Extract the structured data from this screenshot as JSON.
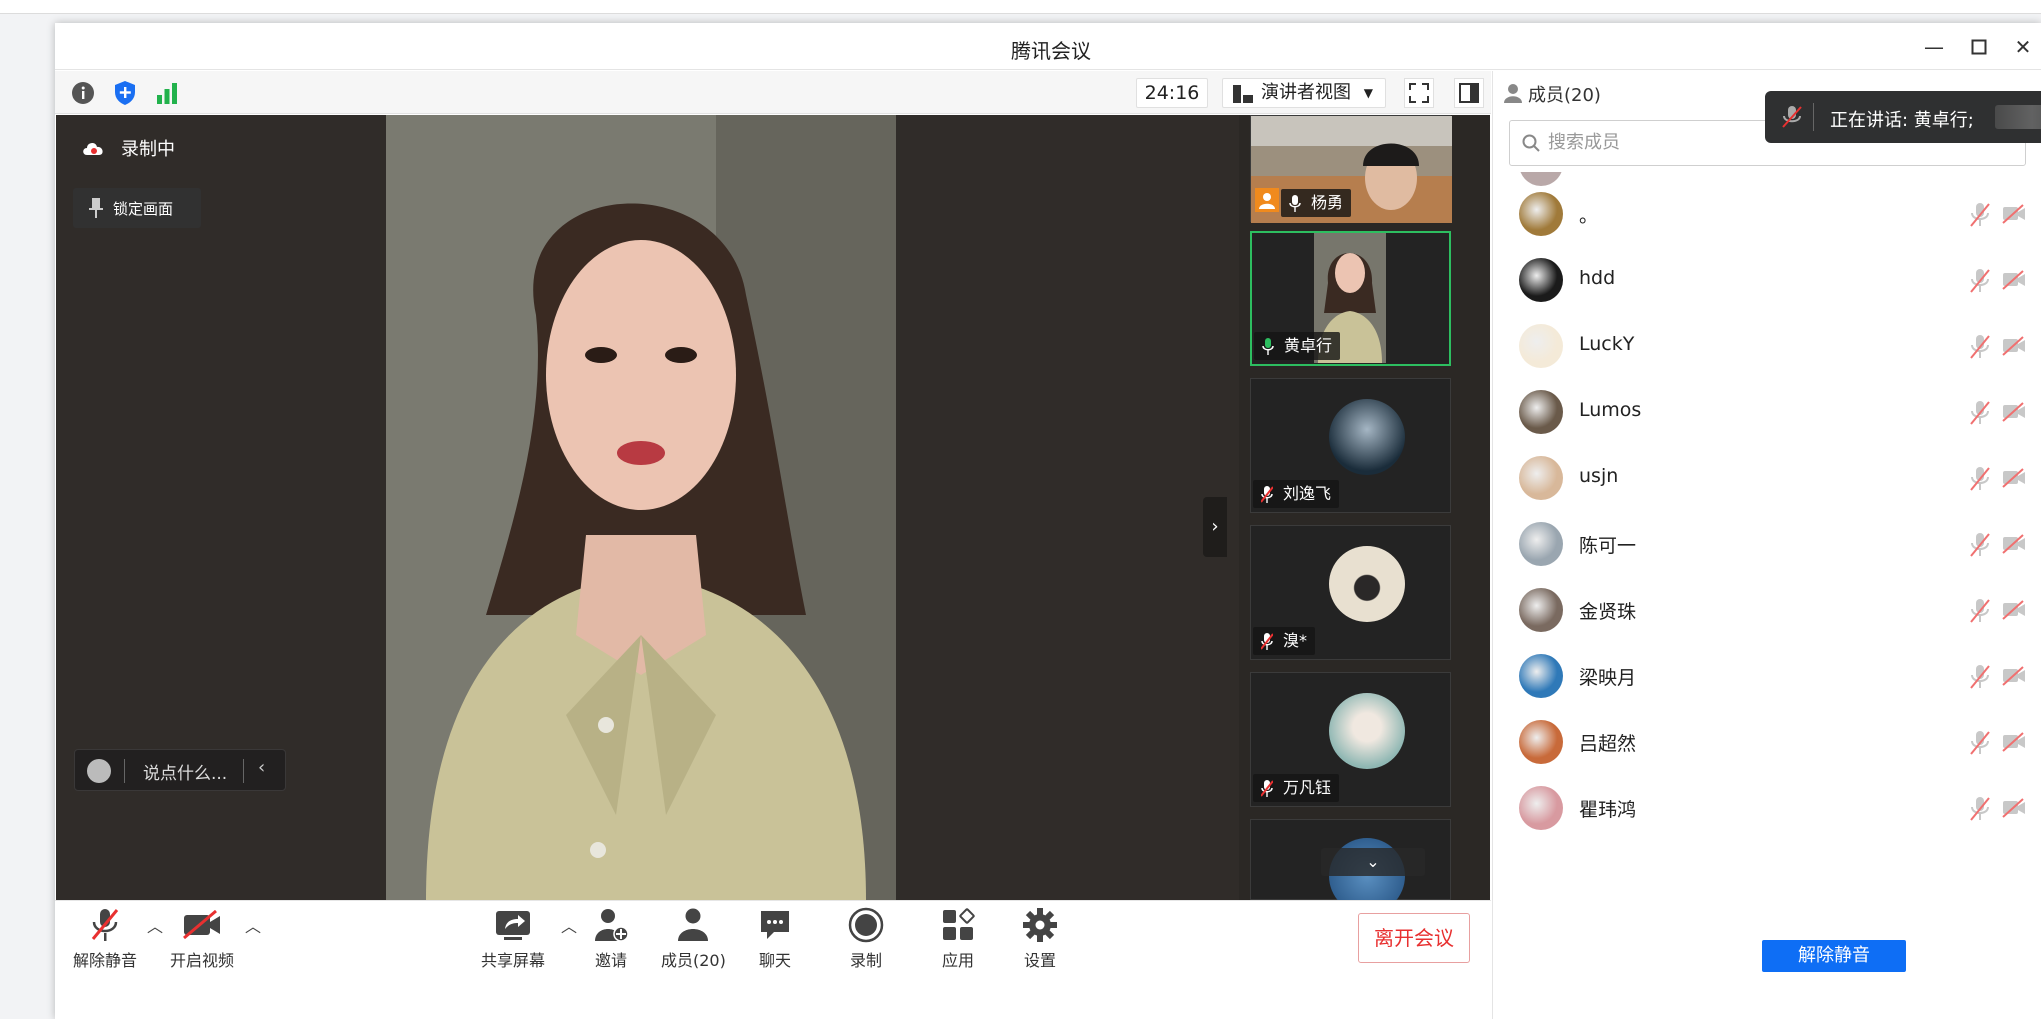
{
  "window": {
    "title": "腾讯会议"
  },
  "toolbar": {
    "timer": "24:16",
    "view_mode": "演讲者视图"
  },
  "stage": {
    "recording_label": "录制中",
    "lock_label": "锁定画面",
    "chat_placeholder": "说点什么..."
  },
  "tiles": [
    {
      "name": "杨勇",
      "mic": "on"
    },
    {
      "name": "黄卓行",
      "mic": "active"
    },
    {
      "name": "刘逸飞",
      "mic": "muted"
    },
    {
      "name": "溴*",
      "mic": "muted"
    },
    {
      "name": "万凡钰",
      "mic": "muted"
    }
  ],
  "panel": {
    "title": "成员(20)",
    "search_placeholder": "搜索成员",
    "speaking": "正在讲话: 黄卓行;",
    "members": [
      "。",
      "hdd",
      "LuckY",
      "Lumos",
      "usjn",
      "陈可一",
      "金贤珠",
      "梁映月",
      "吕超然",
      "瞿玮鸿"
    ],
    "unmute_all": "解除静音"
  },
  "bottom": {
    "unmute": "解除静音",
    "video": "开启视频",
    "share": "共享屏幕",
    "invite": "邀请",
    "members": "成员(20)",
    "chat": "聊天",
    "record": "录制",
    "apps": "应用",
    "settings": "设置",
    "leave": "离开会议"
  },
  "colors": {
    "accent": "#0e6ef5",
    "leave": "#e83030",
    "active_speaker": "#2dbe60",
    "stage_bg": "#302c29"
  }
}
